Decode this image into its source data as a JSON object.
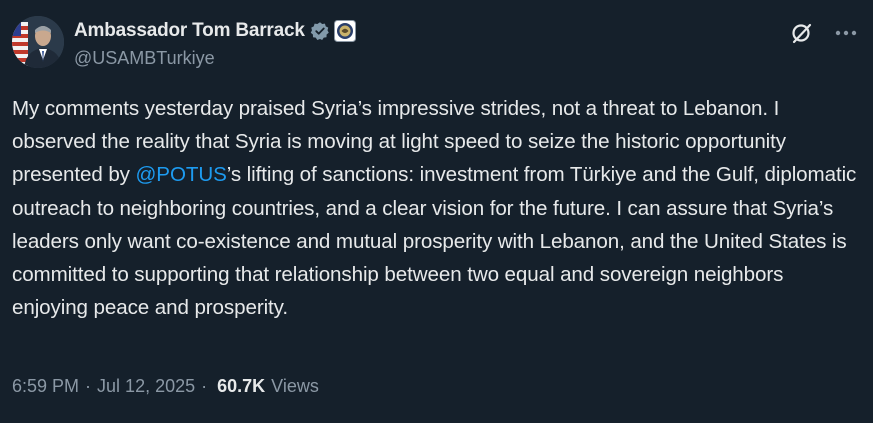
{
  "author": {
    "display_name": "Ambassador Tom Barrack",
    "handle": "@USAMBTurkiye",
    "verified_icon": "verified-badge-icon",
    "affiliation_icon": "us-embassy-seal-icon"
  },
  "actions": {
    "grok_icon": "grok-icon",
    "more_icon": "more-options-icon"
  },
  "tweet": {
    "text_before_mention": "My comments yesterday praised Syria’s impressive strides, not a threat to Lebanon. I observed the reality that Syria is moving at light speed to seize the historic opportunity presented by ",
    "mention": "@POTUS",
    "text_after_mention": "’s lifting of sanctions: investment from Türkiye and the Gulf, diplomatic outreach to neighboring countries, and a clear vision for the future. I can assure that Syria’s leaders only want co-existence and mutual prosperity with Lebanon, and the United States is committed to supporting that relationship between two equal and sovereign neighbors enjoying peace and prosperity."
  },
  "meta": {
    "time": "6:59 PM",
    "separator": "·",
    "date": "Jul 12, 2025",
    "views_count": "60.7K",
    "views_label": "Views"
  },
  "colors": {
    "background": "#15202b",
    "text": "#e7e9ea",
    "secondary": "#8b98a5",
    "accent": "#1d9bf0"
  }
}
